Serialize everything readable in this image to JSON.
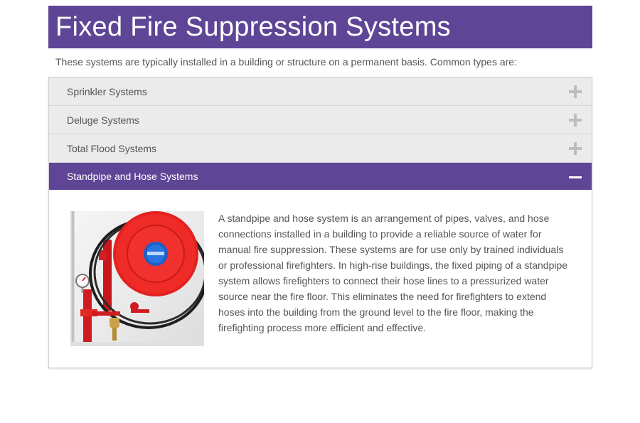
{
  "page": {
    "title": "Fixed Fire Suppression Systems",
    "intro": "These systems are typically installed in a building or structure on a permanent basis. Common types are:"
  },
  "accordion": {
    "items": [
      {
        "label": "Sprinkler Systems",
        "expanded": false
      },
      {
        "label": "Deluge Systems",
        "expanded": false
      },
      {
        "label": "Total Flood Systems",
        "expanded": false
      },
      {
        "label": "Standpipe and Hose Systems",
        "expanded": true
      }
    ],
    "panel_text": "A standpipe and hose system is an arrangement of pipes, valves, and hose connections installed in a building to provide a reliable source of water for manual fire suppression. These systems are for use only by trained individuals or professional firefighters. In high-rise buildings, the fixed piping of a standpipe system allows firefighters to connect their hose lines to a pressurized water source near the fire floor. This eliminates the need for firefighters to extend hoses into the building from the ground level to the fire floor, making the firefighting process more efficient and effective."
  },
  "colors": {
    "brand_purple": "#5e4596",
    "header_gray": "#ebebeb",
    "icon_gray": "#bdbdbd"
  },
  "icons": {
    "collapsed": "plus-icon",
    "expanded": "minus-icon"
  }
}
